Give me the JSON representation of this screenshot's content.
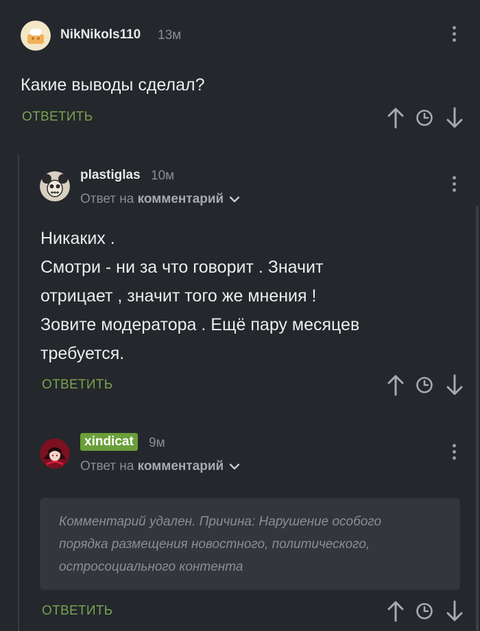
{
  "comments": [
    {
      "username": "NikNikols110",
      "time": "13м",
      "text": "Какие выводы сделал?",
      "reply_label": "ОТВЕТИТЬ"
    },
    {
      "username": "plastiglas",
      "time": "10м",
      "reply_to_prefix": "Ответ на",
      "reply_to_link": "комментарий",
      "lines": [
        "Никаких .",
        "Смотри - ни за что говорит . Значит",
        "отрицает , значит того же мнения !",
        "Зовите модератора . Ещё пару месяцев",
        "требуется."
      ],
      "reply_label": "ОТВЕТИТЬ"
    },
    {
      "username": "xindicat",
      "time": "9м",
      "reply_to_prefix": "Ответ на",
      "reply_to_link": "комментарий",
      "deleted_lines": [
        "Комментарий удален. Причина: Нарушение особого",
        "порядка размещения новостного, политического,",
        "остросоциального контента"
      ],
      "reply_label": "ОТВЕТИТЬ"
    }
  ],
  "icons": {
    "upvote": "arrow-up-icon",
    "history": "clock-icon",
    "downvote": "arrow-down-icon",
    "menu": "more-vertical-icon",
    "expand": "chevron-down-icon"
  },
  "colors": {
    "background": "#24272c",
    "accent": "#7aa251",
    "badge": "#6a9f3a"
  }
}
